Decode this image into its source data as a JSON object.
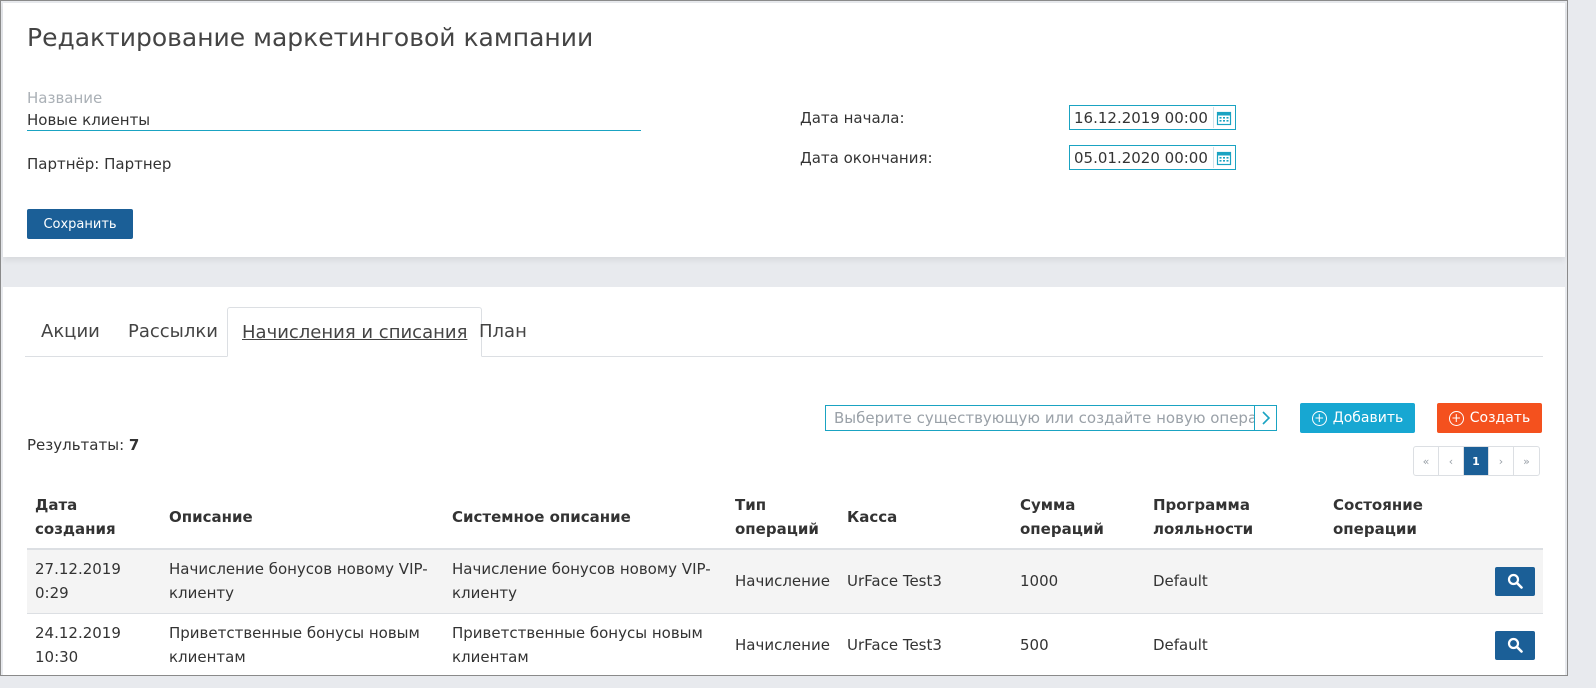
{
  "header": {
    "title": "Редактирование маркетинговой кампании"
  },
  "form": {
    "name_label": "Название",
    "name_value": "Новые клиенты",
    "partner": "Партнёр: Партнер",
    "save_label": "Сохранить",
    "start_label": "Дата начала:",
    "start_value": "16.12.2019 00:00",
    "end_label": "Дата окончания:",
    "end_value": "05.01.2020 00:00"
  },
  "tabs": [
    {
      "label": "Акции",
      "active": false
    },
    {
      "label": "Рассылки",
      "active": false
    },
    {
      "label": "Начисления и списания",
      "active": true
    },
    {
      "label": "План",
      "active": false
    }
  ],
  "toolbar": {
    "search_placeholder": "Выберите существующую или создайте новую операц...",
    "add_label": "Добавить",
    "create_label": "Создать"
  },
  "results": {
    "label": "Результаты:",
    "count": "7"
  },
  "pager": {
    "first": "«",
    "prev": "‹",
    "current": "1",
    "next": "›",
    "last": "»"
  },
  "table": {
    "headers": [
      "Дата создания",
      "Описание",
      "Системное описание",
      "Тип операций",
      "Касса",
      "Сумма операций",
      "Программа лояльности",
      "Состояние операции"
    ],
    "rows": [
      {
        "date": "27.12.2019 0:29",
        "description": "Начисление бонусов новому VIP-клиенту",
        "system_description": "Начисление бонусов новому VIP-клиенту",
        "type": "Начисление",
        "cashbox": "UrFace Test3",
        "amount": "1000",
        "program": "Default",
        "state": ""
      },
      {
        "date": "24.12.2019 10:30",
        "description": "Приветственные бонусы новым клиентам",
        "system_description": "Приветственные бонусы новым клиентам",
        "type": "Начисление",
        "cashbox": "UrFace Test3",
        "amount": "500",
        "program": "Default",
        "state": ""
      }
    ]
  },
  "colors": {
    "primary": "#1b5f97",
    "accent": "#17a7d2",
    "create": "#f4511e",
    "field_border": "#1aa3c2"
  },
  "icons": {
    "calendar": "calendar-icon",
    "search": "search-icon",
    "plus": "plus-circle-icon",
    "chevron": "chevron-right-icon"
  }
}
